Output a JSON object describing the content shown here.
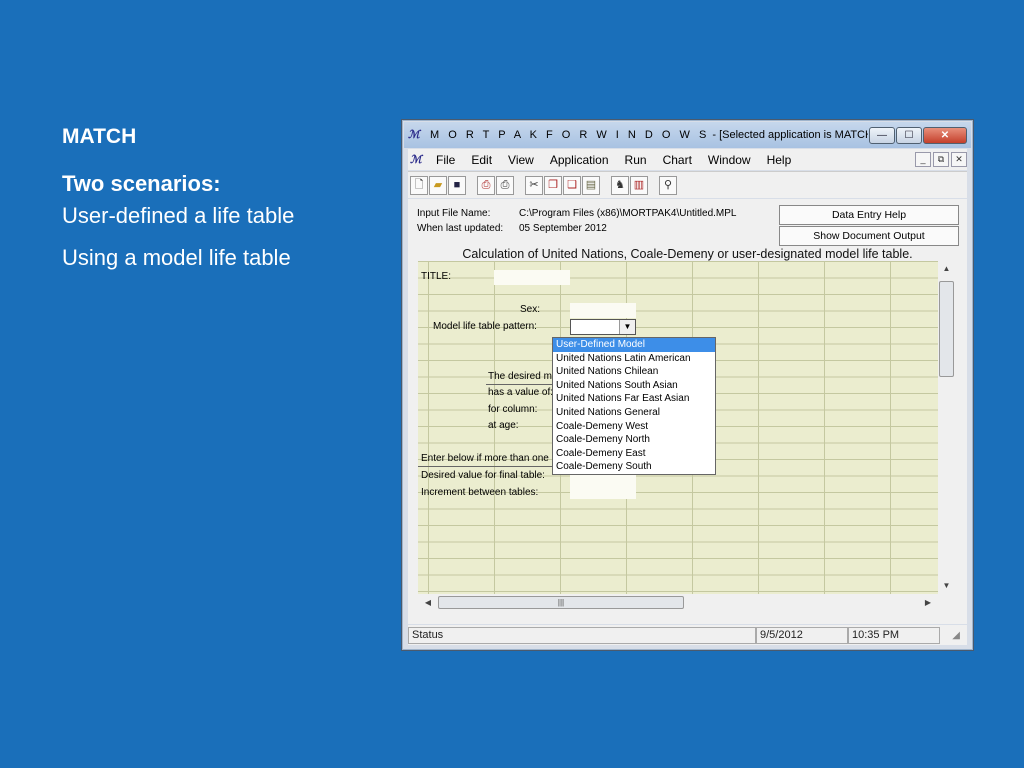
{
  "slide": {
    "heading": "MATCH",
    "subheading": "Two scenarios:",
    "lines": [
      "User-defined a life table",
      "Using a model life table"
    ]
  },
  "window": {
    "title_prefix": "M O R T P A K   F O R   W I N D O W S",
    "title_suffix": " - [Selected application is MATCH  (Untitl...",
    "caption": {
      "minimize": "—",
      "maximize": "☐",
      "close": "✕"
    }
  },
  "menu": {
    "items": [
      "File",
      "Edit",
      "View",
      "Application",
      "Run",
      "Chart",
      "Window",
      "Help"
    ],
    "mdi": {
      "minimize": "_",
      "restore": "⧉",
      "close": "✕"
    }
  },
  "toolbar": {
    "icons": [
      "new-icon",
      "open-icon",
      "save-icon",
      "print-preview-icon",
      "print-icon",
      "cut-icon",
      "copy-icon",
      "paste-icon",
      "clipboard-icon",
      "run-icon",
      "chart-icon",
      "find-icon"
    ]
  },
  "info": {
    "input_file_label": "Input File Name:",
    "input_file_value": "C:\\Program Files (x86)\\MORTPAK4\\Untitled.MPL",
    "updated_label": "When last updated:",
    "updated_value": "05 September 2012",
    "help_button": "Data Entry Help",
    "output_button": "Show Document Output",
    "calc_title": "Calculation of United Nations, Coale-Demeny or user-designated model life table."
  },
  "grid": {
    "title_label": "TITLE:",
    "sex_label": "Sex:",
    "pattern_label": "Model life table pattern:",
    "desired_label": "The desired mo",
    "value_label": "has a value of:",
    "column_label": "for column:",
    "age_label": "at age:",
    "enter_label": "Enter below if more than one",
    "final_label": "Desired value for final table:",
    "increment_label": "Increment between tables:"
  },
  "dropdown": {
    "options": [
      "User-Defined Model",
      "United Nations Latin American",
      "United Nations Chilean",
      "United Nations South Asian",
      "United Nations Far East Asian",
      "United Nations General",
      "Coale-Demeny West",
      "Coale-Demeny North",
      "Coale-Demeny East",
      "Coale-Demeny South"
    ],
    "selected": "User-Defined Model"
  },
  "statusbar": {
    "status": "Status",
    "date": "9/5/2012",
    "time": "10:35 PM"
  },
  "colors": {
    "slide_background": "#1a6fba",
    "grid_background": "#ebedcf",
    "selection": "#3d8ee8"
  }
}
